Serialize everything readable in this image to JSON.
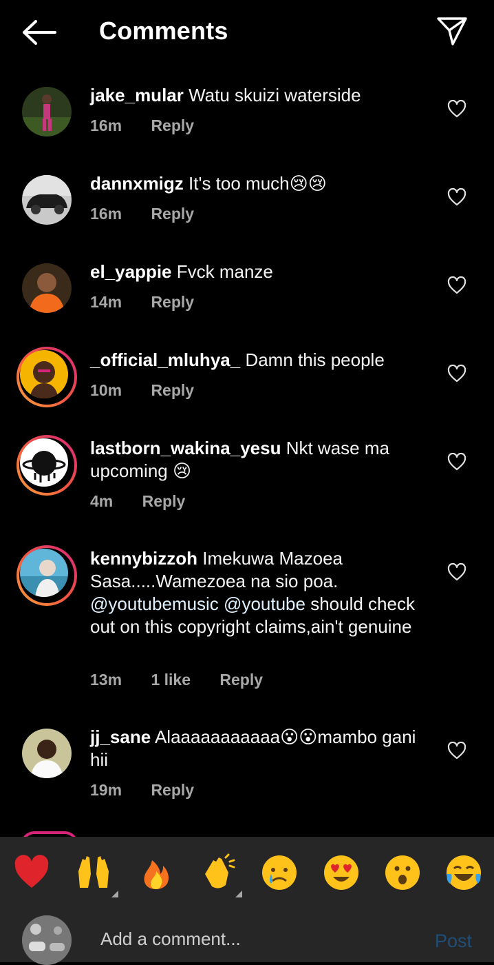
{
  "header": {
    "title": "Comments",
    "back_icon": "arrow-left-icon",
    "share_icon": "paper-plane-icon"
  },
  "comments": [
    {
      "username": "jake_mular",
      "text": "Watu skuizi  waterside",
      "time": "16m",
      "reply": "Reply"
    },
    {
      "username": "dannxmigz",
      "text": "It's too much😢😢",
      "time": "16m",
      "reply": "Reply"
    },
    {
      "username": "el_yappie",
      "text": "Fvck manze",
      "time": "14m",
      "reply": "Reply"
    },
    {
      "username": "_official_mluhya_",
      "text": "Damn this people",
      "time": "10m",
      "reply": "Reply"
    },
    {
      "username": "lastborn_wakina_yesu",
      "text": "Nkt wase ma upcoming 😢",
      "time": "4m",
      "reply": "Reply"
    },
    {
      "username": "kennybizzoh",
      "text_before": "Imekuwa Mazoea Sasa.....Wamezoea na sio poa.",
      "mention1": "@youtubemusic",
      "mention2": "@youtube",
      "text_after": "should check out on this copyright claims,ain't genuine",
      "time": "13m",
      "likes": "1 like",
      "reply": "Reply"
    },
    {
      "username": "jj_sane",
      "text": "Alaaaaaaaaaaa😮😮mambo gani hii",
      "time": "19m",
      "reply": "Reply"
    }
  ],
  "quick_reactions": [
    {
      "name": "red-heart-icon",
      "glyph": "❤️"
    },
    {
      "name": "raising-hands-icon",
      "glyph": "🙌"
    },
    {
      "name": "fire-icon",
      "glyph": "🔥"
    },
    {
      "name": "clapping-hands-icon",
      "glyph": "👏"
    },
    {
      "name": "crying-face-icon",
      "glyph": "😢"
    },
    {
      "name": "heart-eyes-icon",
      "glyph": "😍"
    },
    {
      "name": "surprised-face-icon",
      "glyph": "😮"
    },
    {
      "name": "tears-of-joy-icon",
      "glyph": "😂"
    }
  ],
  "composer": {
    "placeholder": "Add a comment...",
    "post_label": "Post"
  },
  "colors": {
    "background": "#000000",
    "meta_text": "#a8a8a8",
    "post_disabled": "#1f4f78",
    "story_ring_start": "#f9a23a",
    "story_ring_end": "#d6247b"
  }
}
